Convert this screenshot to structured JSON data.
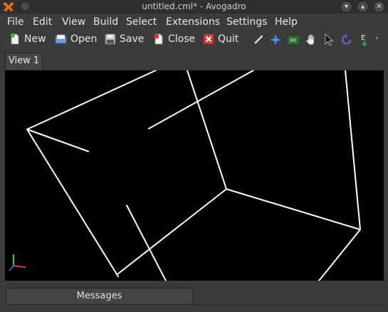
{
  "window": {
    "title": "untitled.cml* - Avogadro"
  },
  "menu": [
    "File",
    "Edit",
    "View",
    "Build",
    "Select",
    "Extensions",
    "Settings",
    "Help"
  ],
  "toolbar": {
    "buttons": [
      {
        "label": "New",
        "icon": "new-document-icon"
      },
      {
        "label": "Open",
        "icon": "open-folder-icon"
      },
      {
        "label": "Save",
        "icon": "save-disk-icon"
      },
      {
        "label": "Close",
        "icon": "close-document-icon"
      },
      {
        "label": "Quit",
        "icon": "quit-icon"
      }
    ],
    "tools": [
      "draw-pencil-icon",
      "navigate-icon",
      "measure-icon",
      "manipulate-hand-icon",
      "select-arrow-icon",
      "auto-rotate-icon",
      "auto-optimize-icon"
    ]
  },
  "tabs": [
    "View 1"
  ],
  "bottom": {
    "messages_tab": "Messages"
  },
  "colors": {
    "background": "#000000",
    "bond": "#ffffff",
    "chrome": "#3b3b3b"
  }
}
